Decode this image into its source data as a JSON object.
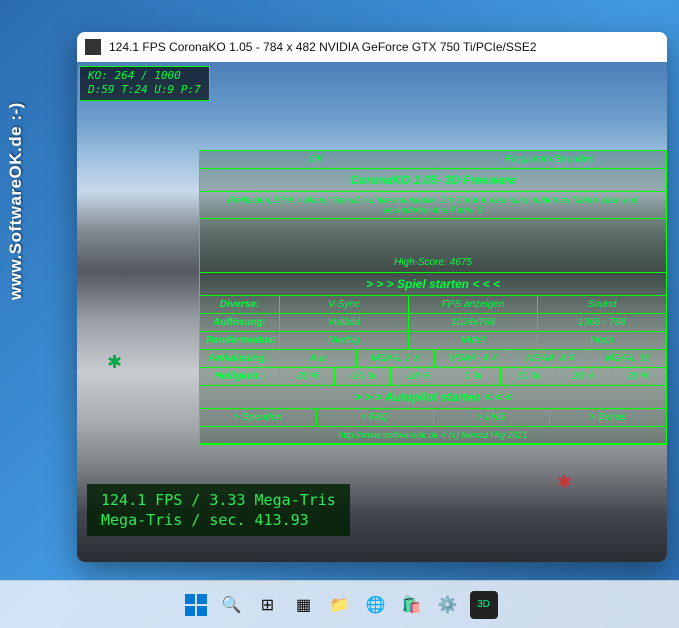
{
  "watermark": "www.SoftwareOK.de :-)",
  "window": {
    "title": "124.1 FPS CoronaKO 1.05 - 784 x 482 NVIDIA GeForce GTX 750 Ti/PCIe/SSE2"
  },
  "hud_top": {
    "line1": "KO: 264 / 1000",
    "line2": "D:59 T:24 U:9 P:7"
  },
  "menu": {
    "top_buttons": {
      "ok": "OK",
      "quit": "Programm Beenden"
    },
    "title": "CoronaKO 1.05- 3D Freeware",
    "subtitle": "Pfeiltasten, Blick = Maus / Schuß = Linke maustaste. Die Corona Viren sind mutiert zu Makro Viren und veränderten ihre Form. S",
    "highscore": "High-Score: 4675",
    "start": "> > > Spiel starten < < <",
    "headers": [
      "Diverse:",
      "V-Sync",
      "FPS anzeigen",
      "Sound"
    ],
    "row_res": {
      "label": "Auflösung:",
      "c1": "Vollbild",
      "c2": "1024x768",
      "c3": "1366 - 768"
    },
    "row_render": {
      "label": "Rendermodus:",
      "c1": "Niedrig",
      "c2": "Mittel",
      "c3": "Hoch"
    },
    "row_aa": {
      "label": "Antialiasing :",
      "c1": "Aus",
      "c2": "MSAA: 2 X",
      "c3": "MSAA: 4 X",
      "c4": "MSAA: 8 X",
      "c5": "MSAA: 16"
    },
    "row_bright": {
      "label": "Helligkeit :",
      "c1": "-30 %",
      "c2": "-20 %",
      "c3": "-10 %",
      "c4": "0 %",
      "c5": "10 %",
      "c6": "20 %",
      "c7": "30 %"
    },
    "autopilot": "> > > Autopilot starten < < <",
    "links": {
      "donate": "> Spenden",
      "faq": "> FAQ",
      "lng": "> LNG",
      "extras": "> Extras"
    },
    "footer": "http://www.softwareok.de // (c) Nenad Hrg 2021"
  },
  "hud_bottom": {
    "line1": "124.1 FPS / 3.33 Mega-Tris",
    "line2": "Mega-Tris / sec. 413.93"
  }
}
